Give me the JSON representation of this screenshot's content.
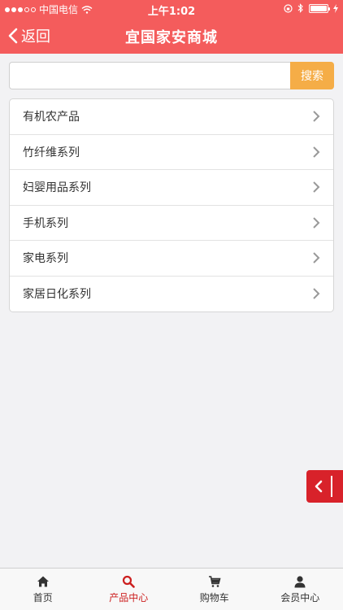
{
  "status": {
    "carrier": "中国电信",
    "time": "上午1:02"
  },
  "header": {
    "back_label": "返回",
    "title": "宜国家安商城"
  },
  "search": {
    "placeholder": "",
    "button_label": "搜索"
  },
  "categories": [
    "有机农产品",
    "竹纤维系列",
    "妇婴用品系列",
    "手机系列",
    "家电系列",
    "家居日化系列"
  ],
  "tabbar": {
    "items": [
      {
        "label": "首页",
        "icon": "home-icon"
      },
      {
        "label": "产品中心",
        "icon": "search-icon"
      },
      {
        "label": "购物车",
        "icon": "cart-icon"
      },
      {
        "label": "会员中心",
        "icon": "user-icon"
      }
    ],
    "active_index": 1
  },
  "colors": {
    "header": "#f45c5c",
    "accent": "#f5ad47",
    "active": "#cc1f1f",
    "side_tab": "#d8222a"
  }
}
